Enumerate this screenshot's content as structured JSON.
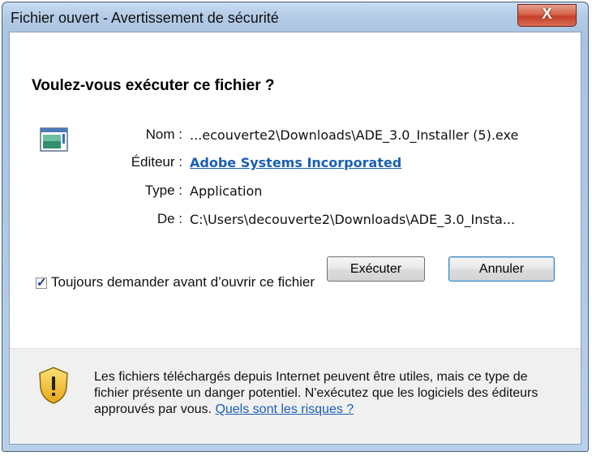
{
  "window": {
    "title": "Fichier ouvert - Avertissement de sécurité",
    "close_label": "X"
  },
  "dialog": {
    "question": "Voulez-vous exécuter ce fichier ?",
    "file_icon": "application-icon",
    "fields": [
      {
        "label": "Nom :",
        "value": "...ecouverte2\\Downloads\\ADE_3.0_Installer (5).exe"
      },
      {
        "label": "Éditeur :",
        "value": "Adobe Systems Incorporated"
      },
      {
        "label": "Type :",
        "value": "Application"
      },
      {
        "label": "De :",
        "value": "C:\\Users\\decouverte2\\Downloads\\ADE_3.0_Insta..."
      }
    ],
    "run_button": "Exécuter",
    "cancel_button": "Annuler",
    "always_ask_checked": true,
    "always_ask_label": "Toujours demander avant d’ouvrir ce fichier"
  },
  "warning": {
    "icon": "shield-warning-icon",
    "text": "Les fichiers téléchargés depuis Internet peuvent être utiles, mais ce type de fichier présente un danger potentiel. N'exécutez que les logiciels des éditeurs approuvés par vous.",
    "link": "Quels sont les risques ?"
  },
  "colors": {
    "link": "#1a5fb4",
    "close_button": "#c8402a",
    "title_bar": "#b3cbe6"
  }
}
